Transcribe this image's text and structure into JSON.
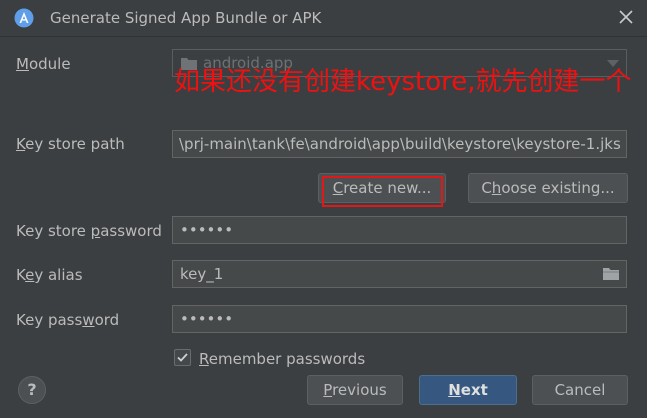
{
  "window": {
    "title": "Generate Signed App Bundle or APK",
    "app_icon": "android-studio-icon",
    "close_icon": "close-icon"
  },
  "module": {
    "label_mnemonic": "M",
    "label_rest": "odule",
    "value": "android.app",
    "icon": "folder-icon"
  },
  "annotation": {
    "text": "如果还没有创建keystore,就先创建一个",
    "color": "#ee1111"
  },
  "key_store_path": {
    "label_mnemonic": "K",
    "label_rest": "ey store path",
    "value": "\\prj-main\\tank\\fe\\android\\app\\build\\keystore\\keystore-1.jks"
  },
  "buttons": {
    "create_new_mnemonic": "C",
    "create_new_rest": "reate new...",
    "choose_existing_pre": "C",
    "choose_existing_mnemonic": "h",
    "choose_existing_rest": "oose existing..."
  },
  "key_store_password": {
    "label_pre": "Key store ",
    "label_mnemonic": "p",
    "label_rest": "assword",
    "value": "••••••"
  },
  "key_alias": {
    "label_pre": "K",
    "label_mnemonic": "e",
    "label_rest": "y alias",
    "value": "key_1",
    "icon": "folder-icon"
  },
  "key_password": {
    "label_pre": "Key pass",
    "label_mnemonic": "w",
    "label_rest": "ord",
    "value": "••••••"
  },
  "remember": {
    "label_mnemonic": "R",
    "label_rest": "emember passwords",
    "checked": true
  },
  "footer": {
    "help": "?",
    "previous_mnemonic": "P",
    "previous_rest": "revious",
    "next_mnemonic": "N",
    "next_rest": "ext",
    "cancel": "Cancel"
  },
  "colors": {
    "background": "#3c3f41",
    "field": "#45494a",
    "accent_button": "#365880",
    "highlight_box": "#e01818"
  }
}
